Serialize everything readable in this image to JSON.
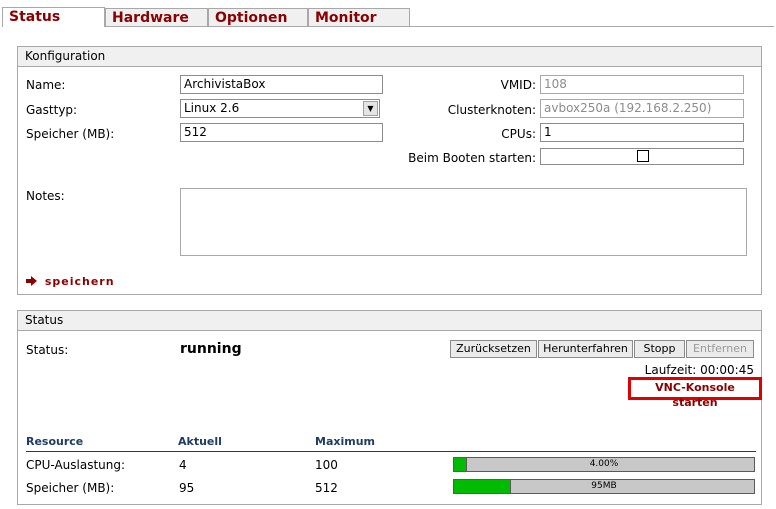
{
  "tabs": [
    {
      "label": "Status",
      "active": true
    },
    {
      "label": "Hardware",
      "active": false
    },
    {
      "label": "Optionen",
      "active": false
    },
    {
      "label": "Monitor",
      "active": false
    }
  ],
  "config": {
    "title": "Konfiguration",
    "name_label": "Name:",
    "name_value": "ArchivistaBox",
    "gasttyp_label": "Gasttyp:",
    "gasttyp_value": "Linux 2.6",
    "speicher_label": "Speicher (MB):",
    "speicher_value": "512",
    "vmid_label": "VMID:",
    "vmid_value": "108",
    "cluster_label": "Clusterknoten:",
    "cluster_value": "avbox250a (192.168.2.250)",
    "cpus_label": "CPUs:",
    "cpus_value": "1",
    "boot_label": "Beim Booten starten:",
    "boot_checked": false,
    "notes_label": "Notes:",
    "notes_value": "",
    "save_label": "speichern"
  },
  "status": {
    "title": "Status",
    "status_label": "Status:",
    "status_value": "running",
    "buttons": {
      "reset": "Zurücksetzen",
      "shutdown": "Herunterfahren",
      "stop": "Stopp",
      "remove": "Entfernen"
    },
    "uptime": "Laufzeit: 00:00:45",
    "vnc_label": "VNC-Konsole starten",
    "table": {
      "headers": [
        "Resource",
        "Aktuell",
        "Maximum"
      ],
      "rows": [
        {
          "resource": "CPU-Auslastung:",
          "current": "4",
          "maximum": "100",
          "bar_label": "4.00%",
          "fraction": 0.04
        },
        {
          "resource": "Speicher (MB):",
          "current": "95",
          "maximum": "512",
          "bar_label": "95MB",
          "fraction": 0.1855
        }
      ]
    }
  },
  "colors": {
    "tab_text": "#8b0000",
    "header_blue": "#1f3c67",
    "bar_fill": "#00bb00",
    "highlight": "#e00000"
  },
  "icons": {
    "save": "arrow-right-icon",
    "select": "triangle-down-icon"
  }
}
